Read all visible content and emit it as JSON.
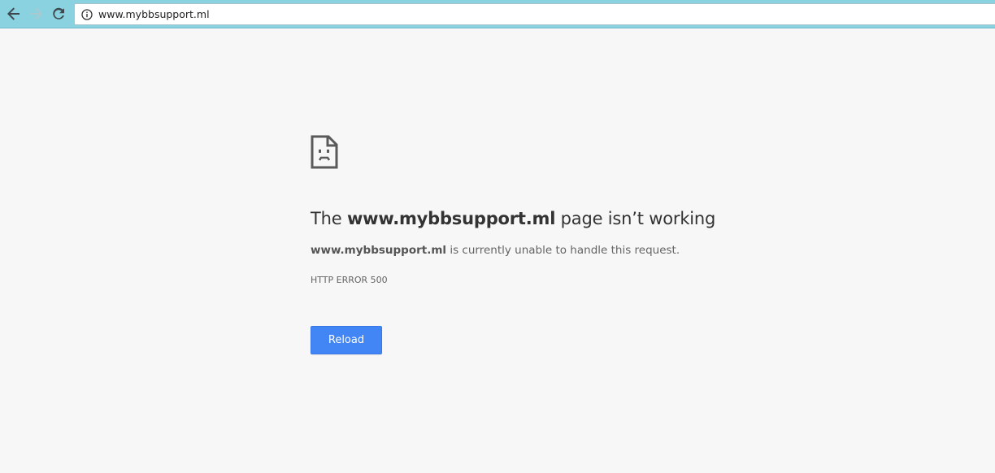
{
  "browser": {
    "url": "www.mybbsupport.ml",
    "icons": {
      "back": "arrow-left-icon",
      "forward": "arrow-right-icon",
      "reload": "reload-icon",
      "site_info": "info-icon"
    },
    "forward_enabled": false
  },
  "error_page": {
    "icon": "sad-document-icon",
    "headline_prefix": "The ",
    "headline_host": "www.mybbsupport.ml",
    "headline_suffix": " page isn’t working",
    "desc_host": "www.mybbsupport.ml",
    "desc_text": " is currently unable to handle this request.",
    "error_code": "HTTP ERROR 500",
    "reload_label": "Reload"
  },
  "colors": {
    "toolbar": "#8ad2e0",
    "page_background": "#f7f7f7",
    "button_blue": "#4285f4"
  }
}
